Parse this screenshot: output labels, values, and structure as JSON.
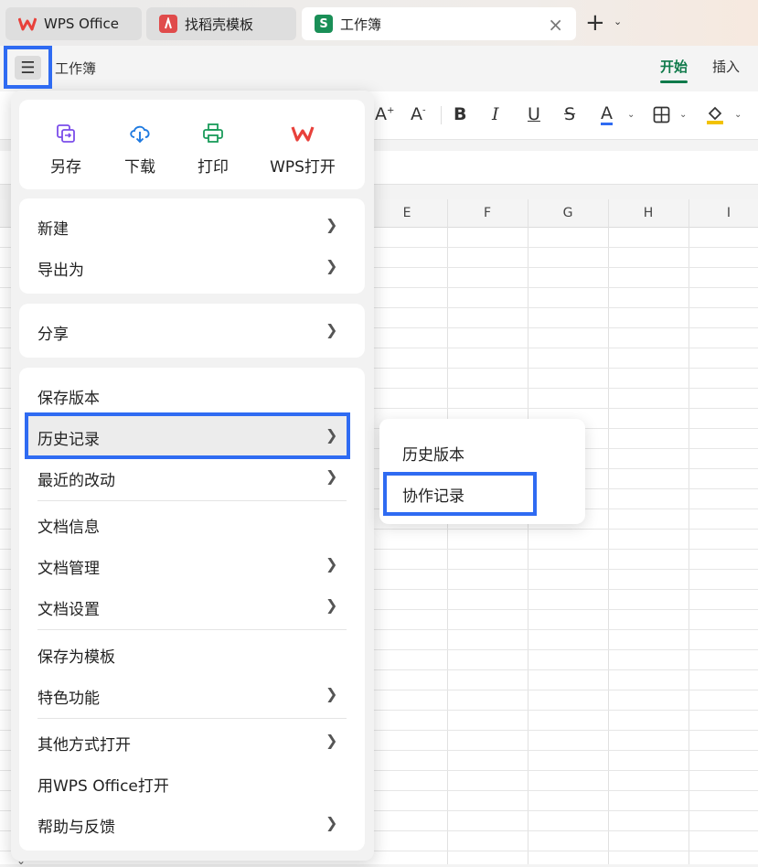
{
  "tabs": [
    {
      "label": "WPS Office",
      "icon": "wps-logo-icon",
      "color": "#e8413b"
    },
    {
      "label": "找稻壳模板",
      "icon": "docer-logo-icon",
      "color": "#e04b4b"
    },
    {
      "label": "工作簿",
      "icon": "spreadsheet-s-icon",
      "icon_text": "S",
      "color": "#1a8f57",
      "active": true
    }
  ],
  "header": {
    "doc_title": "工作簿",
    "ribbon_tabs": [
      "开始",
      "插入"
    ],
    "active_ribbon_tab": "开始"
  },
  "toolbar": {
    "font_increase": "A",
    "font_decrease": "A",
    "bold": "B",
    "italic": "I",
    "underline": "U",
    "strike": "S",
    "font_color": "A"
  },
  "columns": [
    "E",
    "F",
    "G",
    "H",
    "I"
  ],
  "quick_actions": [
    {
      "label": "另存",
      "icon": "save-as-icon"
    },
    {
      "label": "下载",
      "icon": "download-cloud-icon"
    },
    {
      "label": "打印",
      "icon": "printer-icon"
    },
    {
      "label": "WPS打开",
      "icon": "wps-logo-icon"
    }
  ],
  "menu": {
    "new": "新建",
    "export_as": "导出为",
    "share": "分享",
    "save_version": "保存版本",
    "history": "历史记录",
    "recent_changes": "最近的改动",
    "doc_info": "文档信息",
    "doc_manage": "文档管理",
    "doc_settings": "文档设置",
    "save_as_template": "保存为模板",
    "features": "特色功能",
    "open_other": "其他方式打开",
    "open_wps": "用WPS Office打开",
    "help": "帮助与反馈"
  },
  "submenu": {
    "history_version": "历史版本",
    "collab_record": "协作记录"
  },
  "colors": {
    "accent_green": "#0f7a4a",
    "highlight_blue": "#2f6bf2"
  }
}
